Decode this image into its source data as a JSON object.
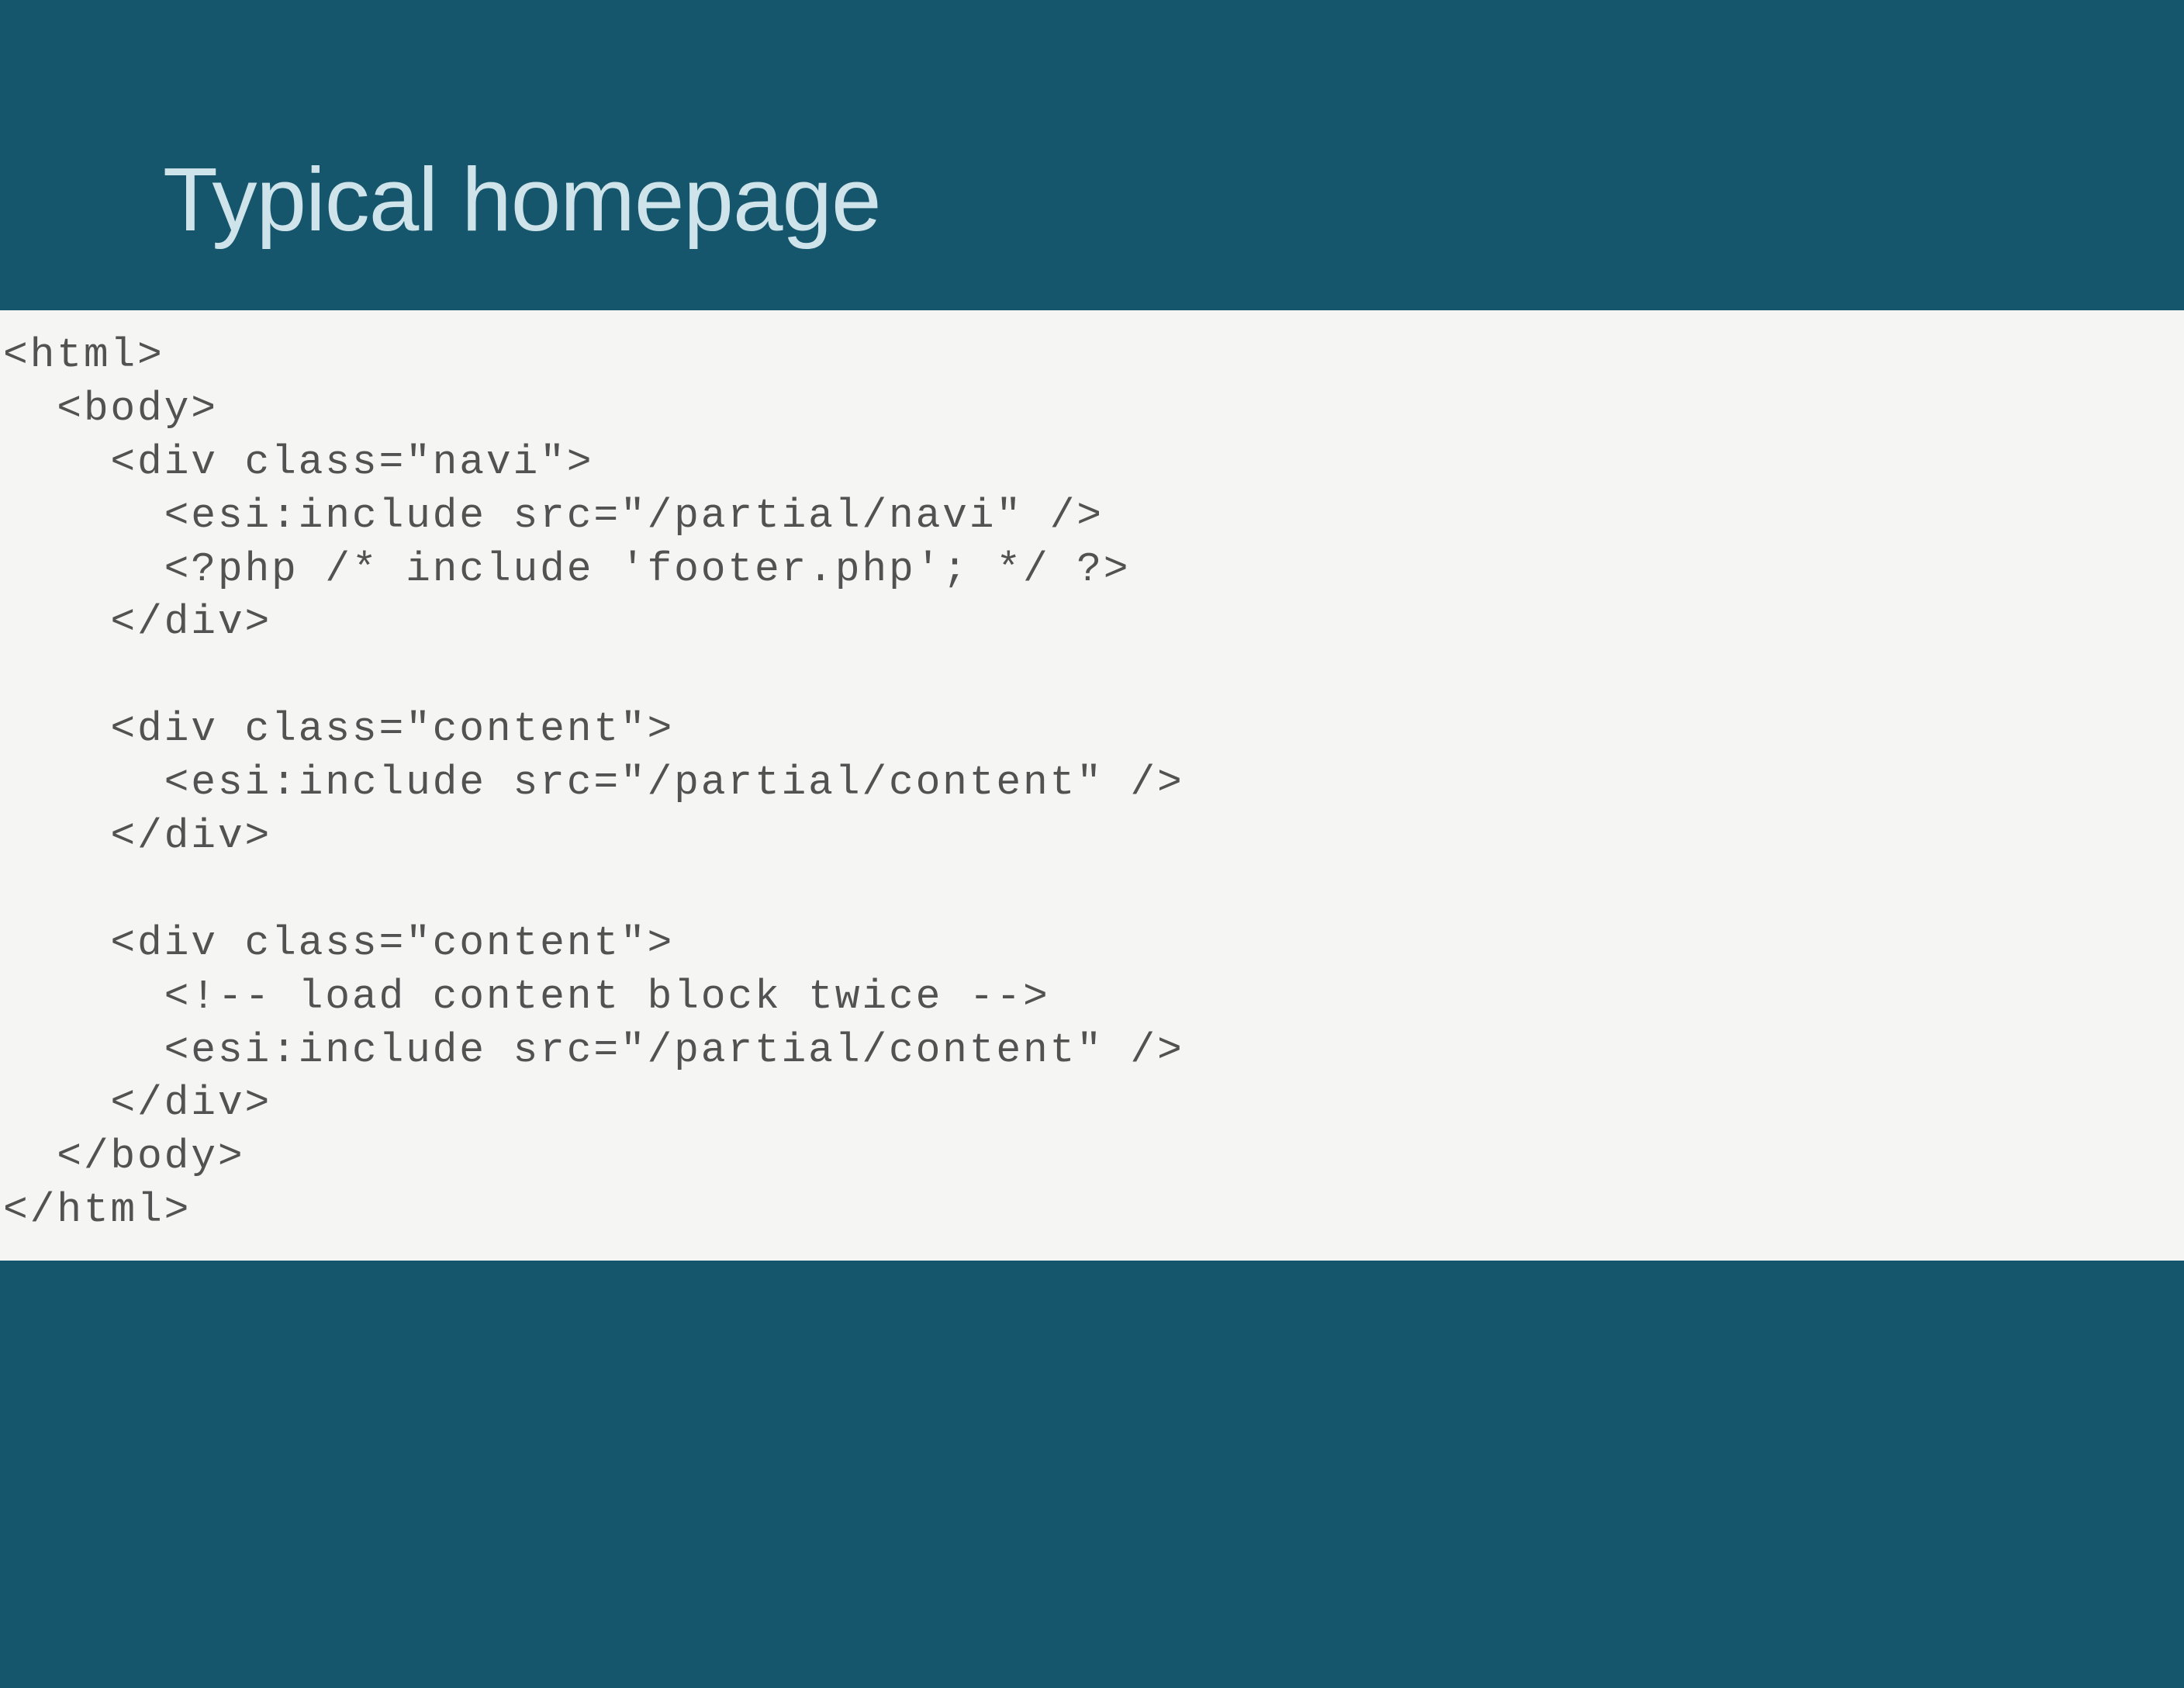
{
  "slide": {
    "title": "Typical homepage",
    "code": "<html>\n  <body>\n    <div class=\"navi\">\n      <esi:include src=\"/partial/navi\" />\n      <?php /* include 'footer.php'; */ ?>\n    </div>\n\n    <div class=\"content\">\n      <esi:include src=\"/partial/content\" />\n    </div>\n\n    <div class=\"content\">\n      <!-- load content block twice -->\n      <esi:include src=\"/partial/content\" />\n    </div>\n  </body>\n</html>"
  },
  "colors": {
    "background": "#16566d",
    "code_background": "#f5f5f4",
    "title_color": "#cfe4ea",
    "code_color": "#525252"
  }
}
